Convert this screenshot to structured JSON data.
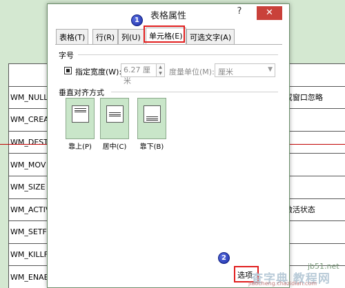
{
  "background_table": {
    "rows": [
      {
        "c1": "",
        "c3": ""
      },
      {
        "c1": "WM_NULL",
        "c3": "或窗口忽略"
      },
      {
        "c1": "WM_CREA",
        "c3": ""
      },
      {
        "c1": "WM_DEST",
        "c3": ""
      },
      {
        "c1": "WM_MOV",
        "c3": ""
      },
      {
        "c1": "WM_SIZE",
        "c3": ""
      },
      {
        "c1": "WM_ACTIV",
        "c3": "激活状态"
      },
      {
        "c1": "WM_SETFO",
        "c3": ""
      },
      {
        "c1": "WM_KILLF",
        "c3": ""
      },
      {
        "c1": "WM_ENAE",
        "c3": ""
      }
    ]
  },
  "dialog": {
    "title": "表格属性",
    "help_glyph": "?",
    "close_glyph": "✕",
    "tabs": [
      {
        "label": "表格(T)"
      },
      {
        "label": "行(R)"
      },
      {
        "label": "列(U)"
      },
      {
        "label": "单元格(E)"
      },
      {
        "label": "可选文字(A)"
      }
    ],
    "size_section": {
      "label": "字号",
      "checkbox_label": "指定宽度(W):",
      "width_value": "6.27 厘米",
      "unit_label": "度量单位(M):",
      "unit_value": "厘米"
    },
    "valign_section": {
      "label": "垂直对齐方式",
      "options": [
        {
          "label": "靠上(P)"
        },
        {
          "label": "居中(C)"
        },
        {
          "label": "靠下(B)"
        }
      ]
    },
    "options_button": "选项"
  },
  "markers": [
    "1",
    "2"
  ],
  "watermark": {
    "site": "jb51.net",
    "cn": "查字典 教程网",
    "url": "jiaocheng.chazidian.com"
  },
  "colors": {
    "accent_red": "#e11d1d",
    "close_red": "#c9413a",
    "background_green": "#d4e8d1",
    "marker_blue": "#1c2fa8"
  }
}
